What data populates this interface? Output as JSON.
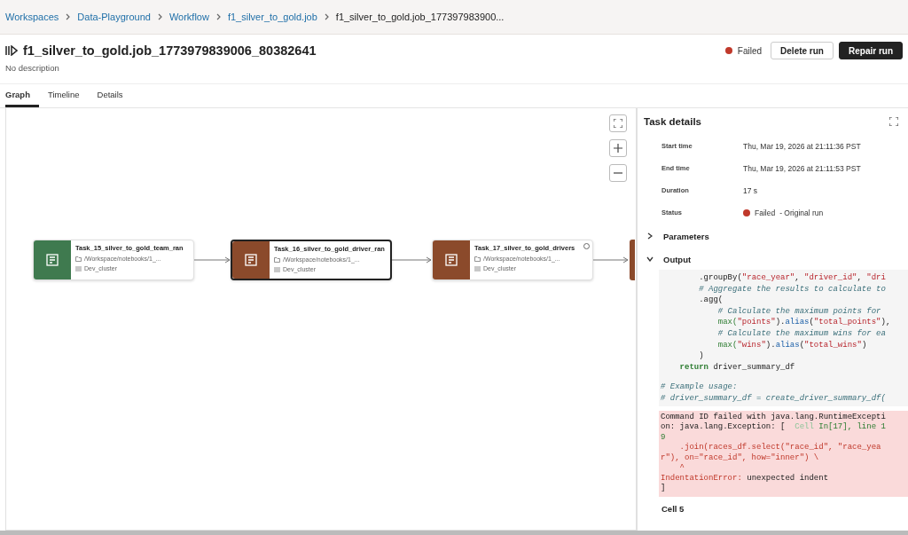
{
  "breadcrumbs": [
    "Workspaces",
    "Data-Playground",
    "Workflow",
    "f1_silver_to_gold.job",
    "f1_silver_to_gold.job_177397983900..."
  ],
  "header": {
    "title": "f1_silver_to_gold.job_1773979839006_80382641",
    "description": "No description",
    "status": "Failed",
    "buttons": [
      {
        "label": "Delete run",
        "kind": "secondary"
      },
      {
        "label": "Repair run",
        "kind": "primary"
      }
    ]
  },
  "tabs": [
    {
      "label": "Graph",
      "selected": true
    },
    {
      "label": "Timeline",
      "selected": false
    },
    {
      "label": "Details",
      "selected": false
    }
  ],
  "graph": {
    "nodes": [
      {
        "name": "Task_15_silver_to_gold_team_ran",
        "path": "/Workspace/notebooks/1_...",
        "cluster": "Dev_cluster",
        "color": "#3f7a4f",
        "selected": false,
        "indicator": false
      },
      {
        "name": "Task_16_silver_to_gold_driver_ran",
        "path": "/Workspace/notebooks/1_...",
        "cluster": "Dev_cluster",
        "color": "#8b4a2b",
        "selected": true,
        "indicator": false
      },
      {
        "name": "Task_17_silver_to_gold_drivers",
        "path": "/Workspace/notebooks/1_...",
        "cluster": "Dev_cluster",
        "color": "#8b4a2b",
        "selected": false,
        "indicator": true
      }
    ],
    "partial_node": {
      "color": "#8b4a2b"
    }
  },
  "panel": {
    "title": "Task details",
    "fields": [
      {
        "label": "Start time",
        "value": "Thu, Mar 19, 2026 at 21:11:36 PST",
        "kind": "text"
      },
      {
        "label": "End time",
        "value": "Thu, Mar 19, 2026 at 21:11:53 PST",
        "kind": "text"
      },
      {
        "label": "Duration",
        "value": "17 s",
        "kind": "text"
      },
      {
        "label": "Status",
        "value": "Failed",
        "note": "- Original run",
        "kind": "status"
      }
    ],
    "sections": [
      {
        "label": "Parameters",
        "expanded": false
      },
      {
        "label": "Output",
        "expanded": true
      }
    ],
    "code": [
      [
        {
          "text": "        .groupBy(",
          "kind": "plain"
        },
        {
          "text": "\"race_year\"",
          "kind": "string"
        },
        {
          "text": ", ",
          "kind": "plain"
        },
        {
          "text": "\"driver_id\"",
          "kind": "string"
        },
        {
          "text": ", ",
          "kind": "plain"
        },
        {
          "text": "\"dri",
          "kind": "string"
        }
      ],
      [
        {
          "text": "        # Aggregate the results to calculate to",
          "kind": "comment"
        }
      ],
      [
        {
          "text": "        .agg(",
          "kind": "plain"
        }
      ],
      [
        {
          "text": "            # Calculate the maximum points for",
          "kind": "comment"
        }
      ],
      [
        {
          "text": "            max(",
          "kind": "func"
        },
        {
          "text": "\"points\"",
          "kind": "string"
        },
        {
          "text": ").",
          "kind": "plain"
        },
        {
          "text": "alias",
          "kind": "method"
        },
        {
          "text": "(",
          "kind": "plain"
        },
        {
          "text": "\"total_points\"",
          "kind": "string"
        },
        {
          "text": "),",
          "kind": "plain"
        }
      ],
      [
        {
          "text": "            # Calculate the maximum wins for ea",
          "kind": "comment"
        }
      ],
      [
        {
          "text": "            max(",
          "kind": "func"
        },
        {
          "text": "\"wins\"",
          "kind": "string"
        },
        {
          "text": ").",
          "kind": "plain"
        },
        {
          "text": "alias",
          "kind": "method"
        },
        {
          "text": "(",
          "kind": "plain"
        },
        {
          "text": "\"total_wins\"",
          "kind": "string"
        },
        {
          "text": ")",
          "kind": "plain"
        }
      ],
      [
        {
          "text": "        )",
          "kind": "plain"
        }
      ],
      [
        {
          "text": "    return",
          "kind": "keyword"
        },
        {
          "text": " driver_summary_df",
          "kind": "plain"
        }
      ]
    ],
    "example": [
      [
        {
          "text": "# Example usage:",
          "kind": "comment"
        }
      ],
      [
        {
          "text": "# driver_summary_df = create_driver_summary_df(",
          "kind": "comment"
        }
      ]
    ],
    "error": [
      [
        {
          "text": "Command ID failed with java.lang.RuntimeExcepti",
          "kind": "plain"
        }
      ],
      [
        {
          "text": "on: java.lang.Exception: [  ",
          "kind": "plain"
        },
        {
          "text": "Cell",
          "kind": "faint"
        },
        {
          "text": " In[17], line 1",
          "kind": "cellref"
        }
      ],
      [
        {
          "text": "9",
          "kind": "cellref"
        }
      ],
      [
        {
          "text": "    .join(races_df.select(\"race_id\", \"race_yea",
          "kind": "err"
        }
      ],
      [
        {
          "text": "r\"), on=\"race_id\", how=\"inner\") \\",
          "kind": "err"
        }
      ],
      [
        {
          "text": "    ^",
          "kind": "err"
        }
      ],
      [
        {
          "text": "IndentationError:",
          "kind": "err"
        },
        {
          "text": " unexpected indent",
          "kind": "plain"
        }
      ],
      [
        {
          "text": "]",
          "kind": "plain"
        }
      ]
    ],
    "next_cell": "Cell 5"
  }
}
